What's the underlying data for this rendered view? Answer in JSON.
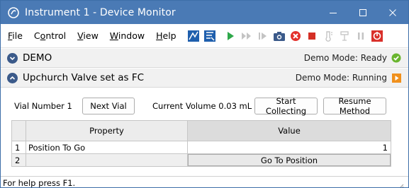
{
  "window": {
    "title": "Instrument 1 - Device Monitor"
  },
  "menu": {
    "items": [
      "File",
      "Control",
      "View",
      "Window",
      "Help"
    ]
  },
  "toolbar": {
    "icons": [
      "chart-import-icon",
      "chart-export-icon",
      "play-icon",
      "fast-forward-icon",
      "step-forward-icon",
      "camera-icon",
      "stop-circle-icon",
      "stop-square-icon",
      "thermometer-icon",
      "fraction-icon",
      "pause-icon",
      "emergency-stop-icon"
    ],
    "colors": {
      "play": "#2ea84a",
      "stop_circle": "#e3312c",
      "stop_square": "#d42f25",
      "emergency": "#d9302a",
      "disabled": "#c4c4c4"
    }
  },
  "sections": {
    "demo": {
      "title": "DEMO",
      "status": "Demo Mode: Ready",
      "status_color": "#6ab52f"
    },
    "valve": {
      "title": "Upchurch Valve set as FC",
      "status": "Demo Mode: Running",
      "status_color": "#f0901c"
    }
  },
  "controls": {
    "vial_number_label": "Vial Number 1",
    "next_vial": "Next Vial",
    "current_volume_label": "Current Volume 0.03 mL",
    "start_collecting": "Start Collecting",
    "resume_method": "Resume Method"
  },
  "grid": {
    "headers": [
      "Property",
      "Value"
    ],
    "rows": [
      {
        "num": "1",
        "property": "Position To Go",
        "value": "1"
      },
      {
        "num": "2",
        "property": "",
        "button": "Go To Position"
      }
    ]
  },
  "statusbar": {
    "text": "For help press F1."
  }
}
